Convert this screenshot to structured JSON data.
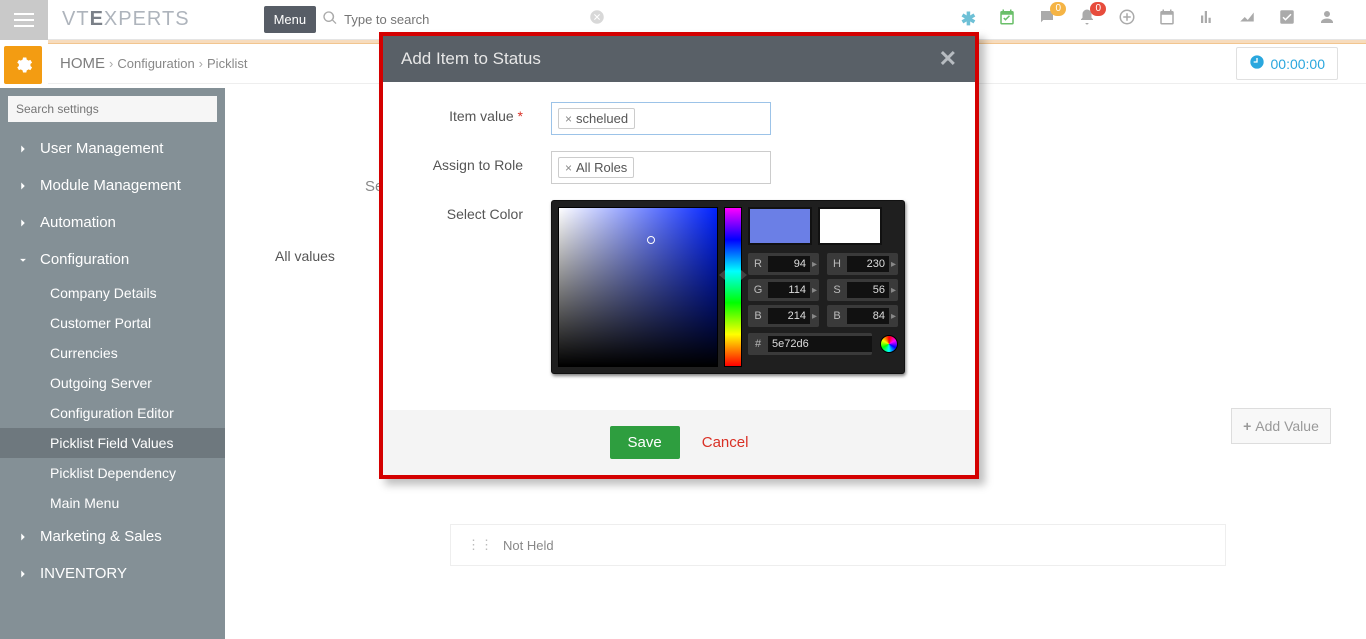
{
  "logo": {
    "pre": "VT",
    "bold": "E",
    "mid": "X",
    "post": "PERTS"
  },
  "menu_btn": "Menu",
  "search_placeholder": "Type to search",
  "top_badges": {
    "chat": "0",
    "bell": "0"
  },
  "breadcrumb": {
    "home": "HOME",
    "l1": "Configuration",
    "l2": "Picklist"
  },
  "timer": "00:00:00",
  "sidebar": {
    "search_placeholder": "Search settings",
    "items": [
      {
        "label": "User Management",
        "open": false
      },
      {
        "label": "Module Management",
        "open": false
      },
      {
        "label": "Automation",
        "open": false
      },
      {
        "label": "Configuration",
        "open": true
      },
      {
        "label": "Marketing & Sales",
        "open": false
      },
      {
        "label": "INVENTORY",
        "open": false
      }
    ],
    "config_children": [
      "Company Details",
      "Customer Portal",
      "Currencies",
      "Outgoing Server",
      "Configuration Editor",
      "Picklist Field Values",
      "Picklist Dependency",
      "Main Menu"
    ],
    "active_child": "Picklist Field Values"
  },
  "main": {
    "select_label_partial": "Sele",
    "tab": "All values",
    "add_value": "Add Value",
    "row_value": "Not Held"
  },
  "modal": {
    "title": "Add Item to Status",
    "item_value_label": "Item value",
    "item_value": "schelued",
    "assign_role_label": "Assign to Role",
    "assign_role_value": "All Roles",
    "select_color_label": "Select Color",
    "color": {
      "R": "94",
      "G": "114",
      "B": "214",
      "H": "230",
      "S": "56",
      "Bv": "84",
      "hex": "5e72d6",
      "swatch1": "#6b7fe6",
      "swatch2": "#ffffff"
    },
    "save": "Save",
    "cancel": "Cancel"
  }
}
